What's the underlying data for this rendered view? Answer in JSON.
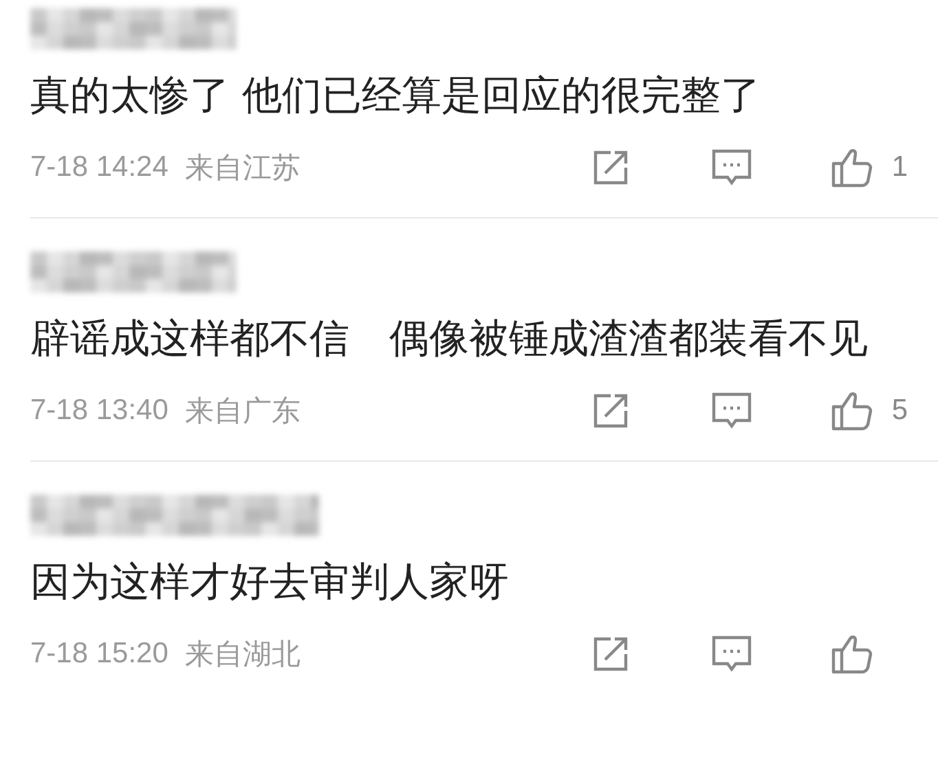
{
  "comments": [
    {
      "text": "真的太惨了 他们已经算是回应的很完整了",
      "time": "7-18 14:24",
      "location": "来自江苏",
      "likes": "1"
    },
    {
      "text": "辟谣成这样都不信　偶像被锤成渣渣都装看不见",
      "time": "7-18 13:40",
      "location": "来自广东",
      "likes": "5"
    },
    {
      "text": "因为这样才好去审判人家呀",
      "time": "7-18 15:20",
      "location": "来自湖北"
    }
  ]
}
